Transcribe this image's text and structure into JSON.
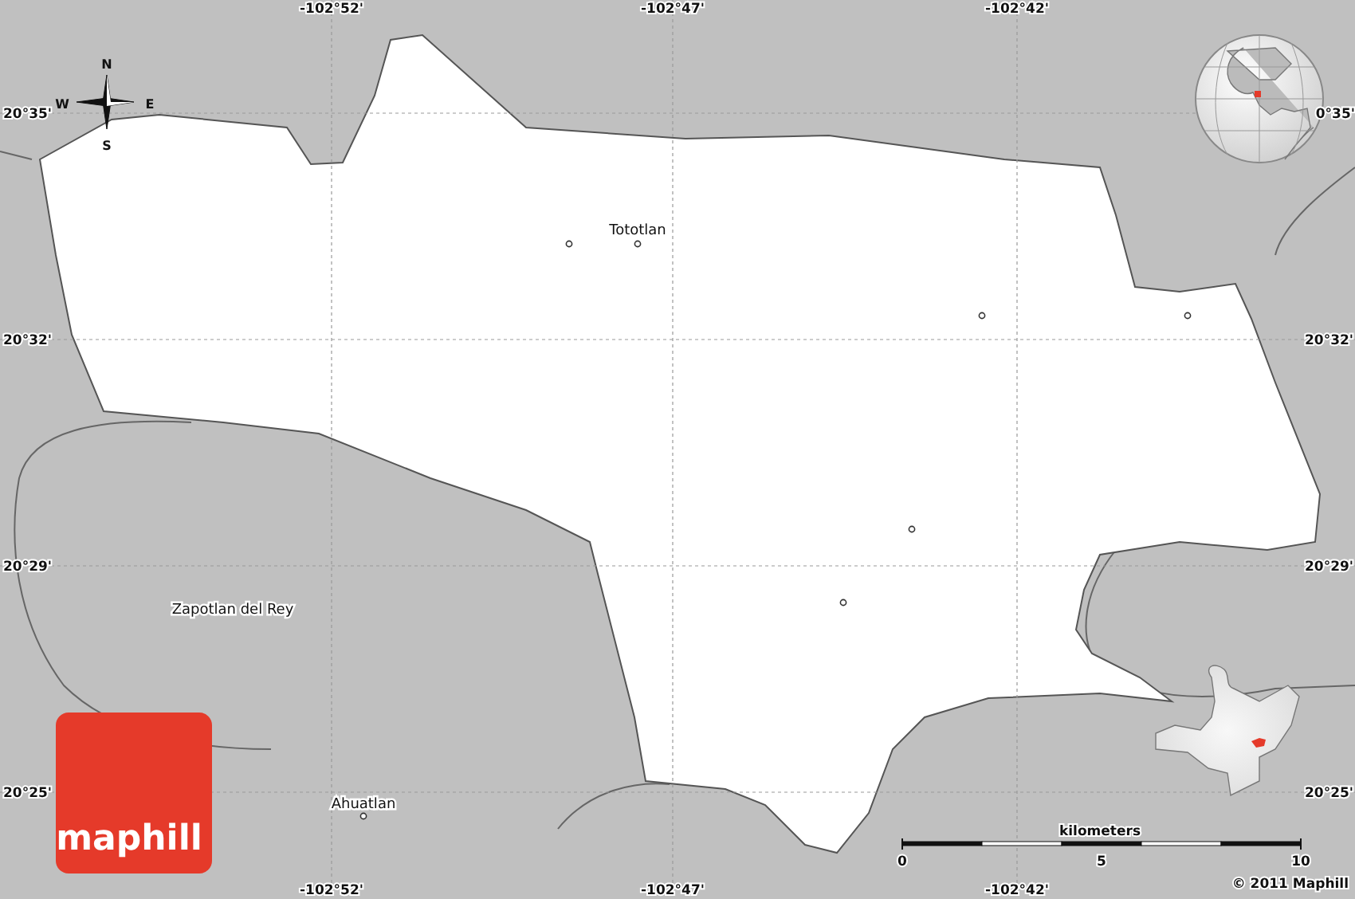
{
  "map": {
    "grid_labels": {
      "top": [
        "-102°52'",
        "-102°47'",
        "-102°42'"
      ],
      "bottom": [
        "-102°52'",
        "-102°47'",
        "-102°42'"
      ],
      "left": [
        "20°35'",
        "20°32'",
        "20°29'",
        "20°25'"
      ],
      "right": [
        "0°35'",
        "20°32'",
        "20°29'",
        "20°25'"
      ]
    },
    "places": [
      {
        "name": "Tototlan"
      },
      {
        "name": "Zapotlan del Rey"
      },
      {
        "name": "Ahuatlan"
      }
    ],
    "compass": [
      "N",
      "E",
      "S",
      "W"
    ],
    "scale": {
      "title": "kilometers",
      "ticks": [
        "0",
        "5",
        "10"
      ]
    },
    "copyright": "© 2011 Maphill",
    "logo": "maphill"
  }
}
